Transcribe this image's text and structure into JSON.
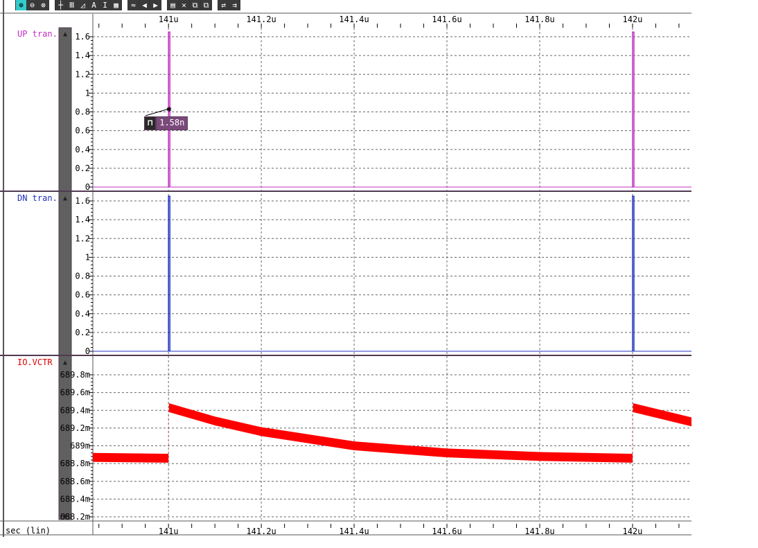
{
  "toolbar": {
    "groups": [
      [
        "zoom-in",
        "zoom-out",
        "zoom-fit"
      ],
      [
        "cursor",
        "bars",
        "slope",
        "annotate",
        "measure",
        "grid"
      ],
      [
        "wave",
        "prev",
        "next"
      ],
      [
        "stack",
        "delete",
        "group",
        "ungroup"
      ],
      [
        "swap",
        "export"
      ]
    ],
    "glyphs": {
      "zoom-in": "⊕",
      "zoom-out": "⊖",
      "zoom-fit": "⊗",
      "cursor": "┼",
      "bars": "Ⅲ",
      "slope": "◿",
      "annotate": "A",
      "measure": "I",
      "grid": "▦",
      "wave": "≈",
      "prev": "◀",
      "next": "▶",
      "stack": "▤",
      "delete": "✕",
      "group": "⧉",
      "ungroup": "⧉",
      "swap": "⇄",
      "export": "⇉"
    }
  },
  "panels": [
    {
      "label": "UP tran.",
      "color": "#c030c0"
    },
    {
      "label": "DN tran.",
      "color": "#2030c0"
    },
    {
      "label": "IO.VCTR",
      "color": "#e00000"
    }
  ],
  "marker": {
    "value": "1.58n"
  },
  "xaxis": {
    "title": "sec (lin)"
  },
  "chart_data": [
    {
      "type": "line",
      "title": "UP tran.",
      "xlim": [
        140.837,
        142.127
      ],
      "x_unit": "u",
      "xticks": [
        141.0,
        141.2,
        141.4,
        141.6,
        141.8,
        142.0
      ],
      "xtick_labels": [
        "141u",
        "141.2u",
        "141.4u",
        "141.6u",
        "141.8u",
        "142u"
      ],
      "ylim": [
        0,
        1.6
      ],
      "yticks": [
        0,
        0.2,
        0.4,
        0.6,
        0.8,
        1,
        1.2,
        1.4,
        1.6
      ],
      "ytick_labels": [
        "0",
        "0.2",
        "0.4",
        "0.6",
        "0.8",
        "1",
        "1.2",
        "1.4",
        "1.6"
      ],
      "pulses": [
        {
          "t": 141.0,
          "peak": 1.65
        },
        {
          "t": 142.0,
          "peak": 1.65
        }
      ],
      "baseline": 0,
      "color": "#c030c0"
    },
    {
      "type": "line",
      "title": "DN tran.",
      "xlim": [
        140.837,
        142.127
      ],
      "ylim": [
        0,
        1.6
      ],
      "yticks": [
        0,
        0.2,
        0.4,
        0.6,
        0.8,
        1,
        1.2,
        1.4,
        1.6
      ],
      "ytick_labels": [
        "0",
        "0.2",
        "0.4",
        "0.6",
        "0.8",
        "1",
        "1.2",
        "1.4",
        "1.6"
      ],
      "pulses": [
        {
          "t": 141.0,
          "peak": 1.65
        },
        {
          "t": 142.0,
          "peak": 1.65
        }
      ],
      "baseline": 0,
      "color": "#2030c0"
    },
    {
      "type": "area",
      "title": "IO.VCTR",
      "xlim": [
        140.837,
        142.127
      ],
      "ylim": [
        688.2,
        689.8
      ],
      "yticks": [
        688.2,
        688.4,
        688.6,
        688.8,
        689.0,
        689.2,
        689.4,
        689.6,
        689.8
      ],
      "ytick_labels": [
        "688.2m",
        "688.4m",
        "688.6m",
        "688.8m",
        "689m",
        "689.2m",
        "689.4m",
        "689.6m",
        "689.8m"
      ],
      "band_width": 0.1,
      "x": [
        140.837,
        141.0,
        141.001,
        141.1,
        141.2,
        141.4,
        141.6,
        141.8,
        142.0,
        142.001,
        142.127
      ],
      "y": [
        688.87,
        688.86,
        689.43,
        689.28,
        689.16,
        689.0,
        688.92,
        688.88,
        688.86,
        689.43,
        689.27
      ],
      "color": "#ff0000"
    }
  ]
}
